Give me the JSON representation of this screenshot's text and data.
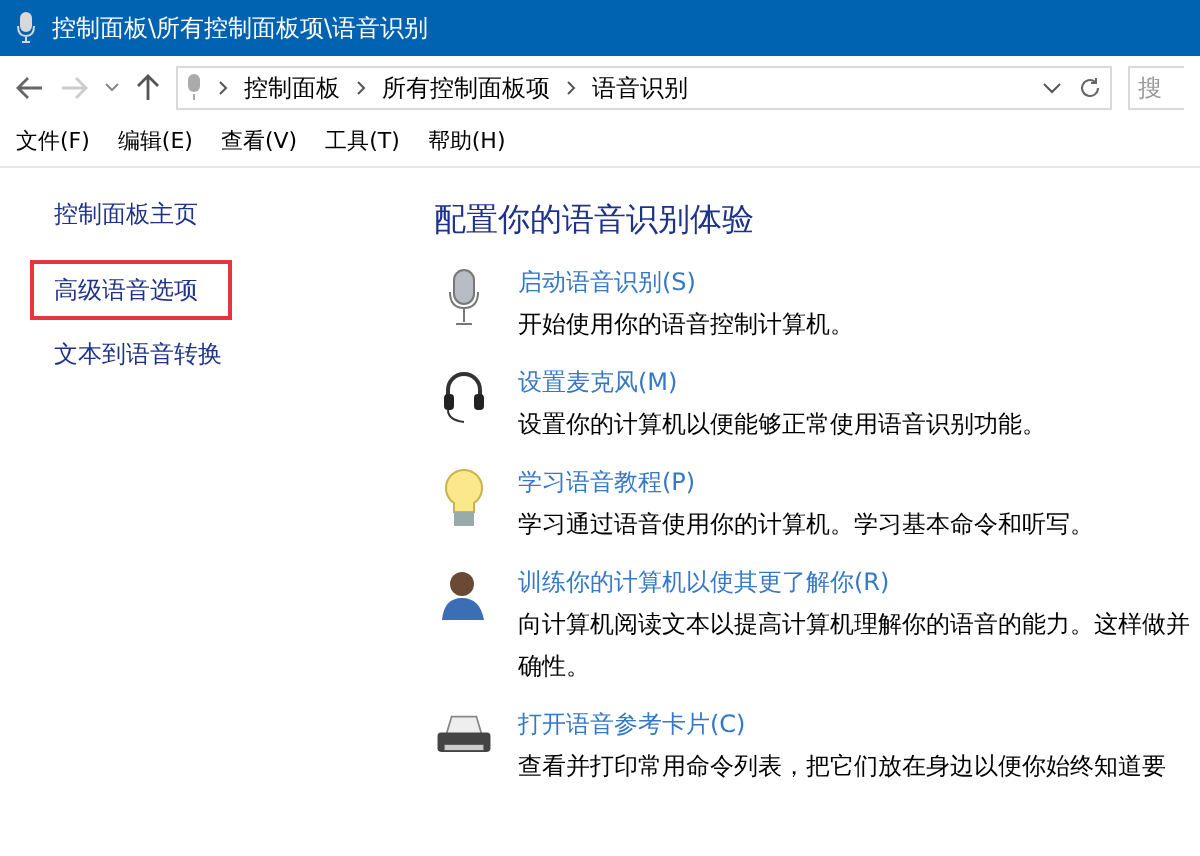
{
  "window": {
    "title": "控制面板\\所有控制面板项\\语音识别"
  },
  "address_bar": {
    "crumbs": [
      "控制面板",
      "所有控制面板项",
      "语音识别"
    ],
    "search_placeholder": "搜"
  },
  "menu": [
    "文件(F)",
    "编辑(E)",
    "查看(V)",
    "工具(T)",
    "帮助(H)"
  ],
  "sidebar": {
    "items": [
      {
        "label": "控制面板主页",
        "highlighted": false
      },
      {
        "label": "高级语音选项",
        "highlighted": true
      },
      {
        "label": "文本到语音转换",
        "highlighted": false
      }
    ]
  },
  "heading": "配置你的语音识别体验",
  "tasks": [
    {
      "kind": "microphone",
      "link": "启动语音识别(S)",
      "description": [
        "开始使用你的语音控制计算机。"
      ]
    },
    {
      "kind": "headset",
      "link": "设置麦克风(M)",
      "description": [
        "设置你的计算机以便能够正常使用语音识别功能。"
      ]
    },
    {
      "kind": "bulb",
      "link": "学习语音教程(P)",
      "description": [
        "学习通过语音使用你的计算机。学习基本命令和听写。"
      ]
    },
    {
      "kind": "person",
      "link": "训练你的计算机以使其更了解你(R)",
      "description": [
        "向计算机阅读文本以提高计算机理解你的语音的能力。这样做并",
        "确性。"
      ]
    },
    {
      "kind": "printer",
      "link": "打开语音参考卡片(C)",
      "description": [
        "查看并打印常用命令列表，把它们放在身边以便你始终知道要"
      ]
    }
  ]
}
